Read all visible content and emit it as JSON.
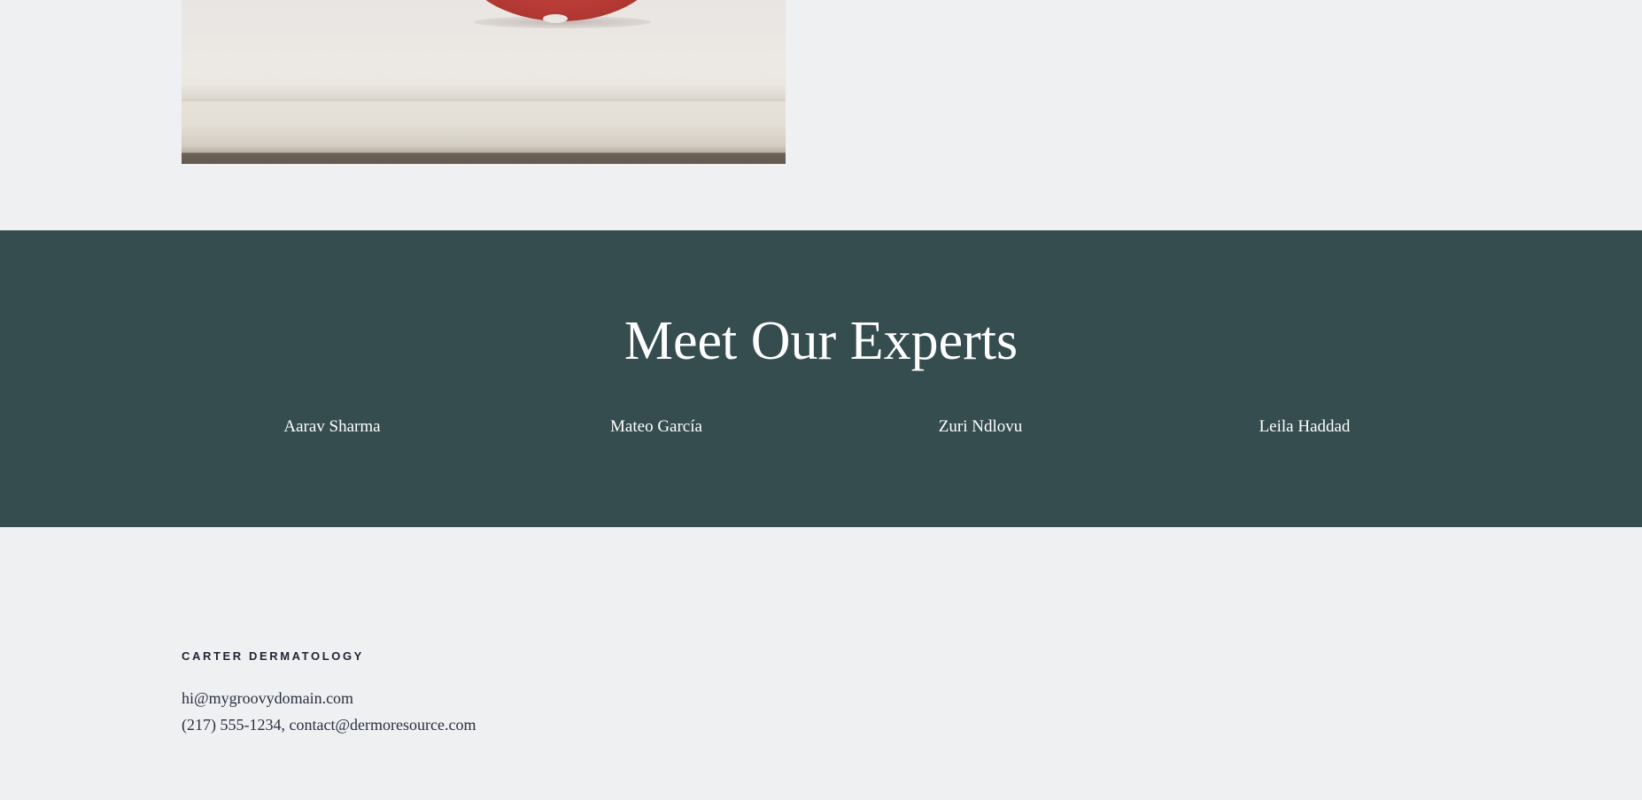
{
  "hero": {
    "image_alt": "red apple on white surface"
  },
  "experts": {
    "title": "Meet Our Experts",
    "names": [
      "Aarav Sharma",
      "Mateo García",
      "Zuri Ndlovu",
      "Leila Haddad"
    ],
    "background_color": "#354d4f"
  },
  "footer": {
    "brand": "CARTER DERMATOLOGY",
    "email": "hi@mygroovydomain.com",
    "contact": "(217) 555-1234, contact@dermoresource.com"
  },
  "colors": {
    "page_background": "#eff0f2",
    "text_dark": "#1e2433"
  }
}
